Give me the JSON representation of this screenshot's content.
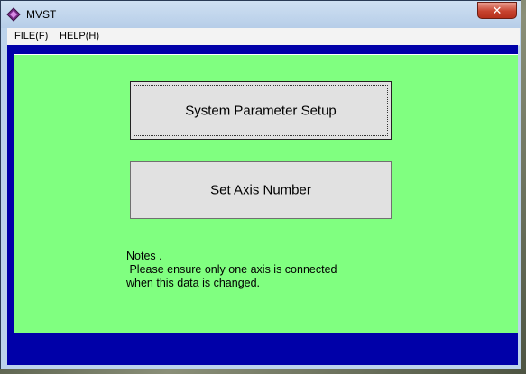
{
  "window": {
    "title": "MVST",
    "close_symbol": "✕"
  },
  "menu": {
    "items": [
      {
        "label": "FILE(F)"
      },
      {
        "label": "HELP(H)"
      }
    ]
  },
  "buttons": {
    "system_parameter_setup": "System Parameter Setup",
    "set_axis_number": "Set Axis Number"
  },
  "notes": {
    "heading": "Notes .",
    "line1": " Please ensure only one axis is connected",
    "line2": "when this data is changed."
  },
  "colors": {
    "panel_background": "#80ff80",
    "client_border": "#0000a8",
    "button_face": "#e1e1e1"
  },
  "icons": {
    "app": "app-diamond-icon",
    "close": "close-icon"
  }
}
